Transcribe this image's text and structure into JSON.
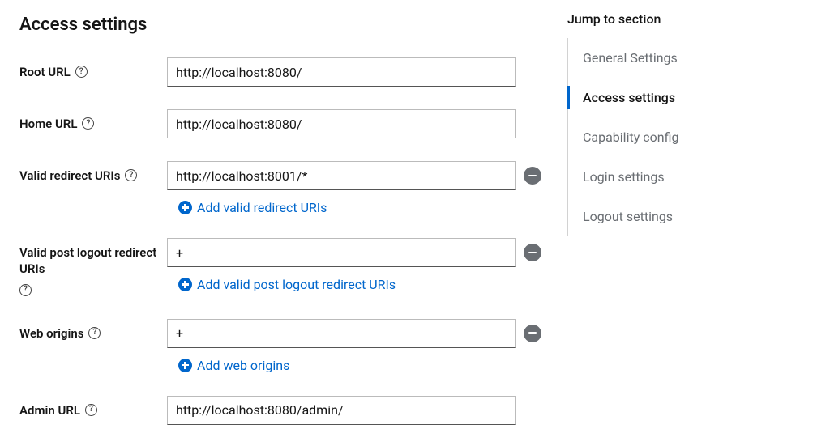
{
  "section_title": "Access settings",
  "fields": {
    "root_url": {
      "label": "Root URL",
      "value": "http://localhost:8080/"
    },
    "home_url": {
      "label": "Home URL",
      "value": "http://localhost:8080/"
    },
    "valid_redirect": {
      "label": "Valid redirect URIs",
      "value": "http://localhost:8001/*",
      "add_label": "Add valid redirect URIs"
    },
    "valid_logout": {
      "label": "Valid post logout redirect URIs",
      "value": "+",
      "add_label": "Add valid post logout redirect URIs"
    },
    "web_origins": {
      "label": "Web origins",
      "value": "+",
      "add_label": "Add web origins"
    },
    "admin_url": {
      "label": "Admin URL",
      "value": "http://localhost:8080/admin/"
    }
  },
  "jump": {
    "title": "Jump to section",
    "items": [
      "General Settings",
      "Access settings",
      "Capability config",
      "Login settings",
      "Logout settings"
    ],
    "active_index": 1
  }
}
